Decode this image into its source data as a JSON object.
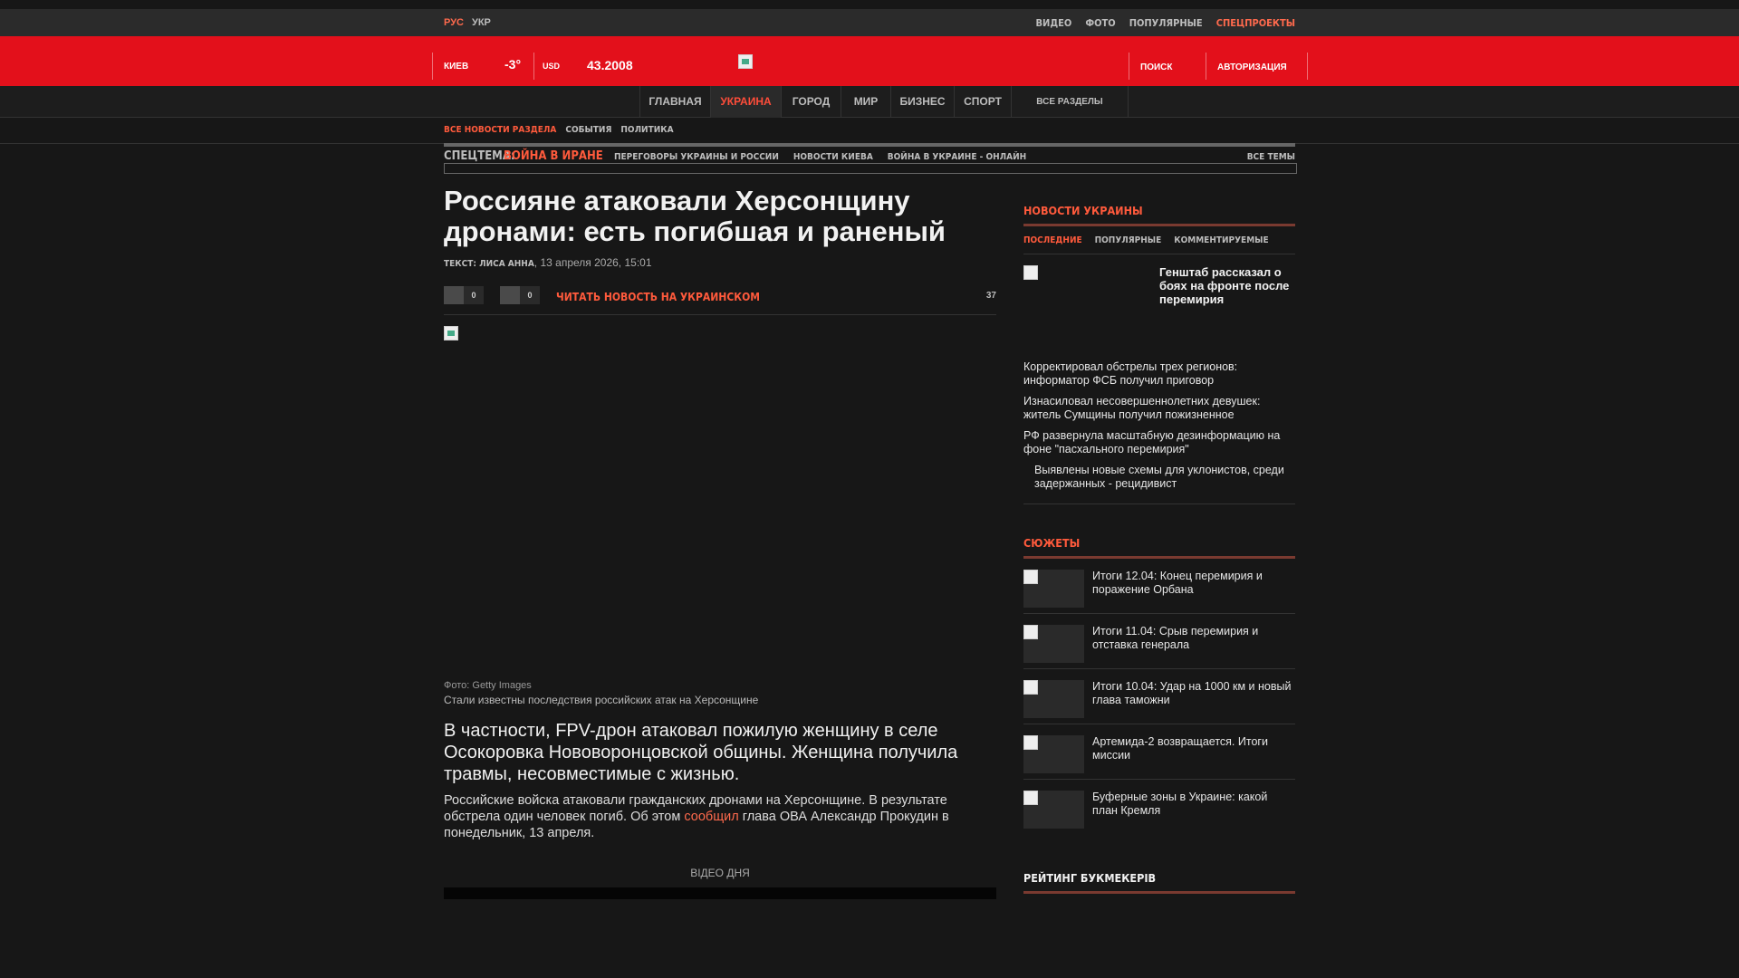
{
  "topbar": {
    "lang_ru": "РУС",
    "lang_ua": "УКР",
    "links": [
      {
        "label": "ВИДЕО",
        "active": false
      },
      {
        "label": "ФОТО",
        "active": false
      },
      {
        "label": "ПОПУЛЯРНЫЕ",
        "active": false
      },
      {
        "label": "СПЕЦПРОЕКТЫ",
        "active": true
      }
    ]
  },
  "header": {
    "city": "КИЕВ",
    "temperature": "-3°",
    "currency": "USD",
    "rate": "43.2008",
    "search": "ПОИСК",
    "auth": "АВТОРИЗАЦИЯ"
  },
  "nav": {
    "items": [
      {
        "label": "ГЛАВНАЯ"
      },
      {
        "label": "УКРАИНА"
      },
      {
        "label": "ГОРОД"
      },
      {
        "label": "МИР"
      },
      {
        "label": "БИЗНЕС"
      },
      {
        "label": "СПОРТ"
      },
      {
        "label": "ВСЕ РАЗДЕЛЫ"
      }
    ]
  },
  "subnav": {
    "items": [
      "ВСЕ НОВОСТИ РАЗДЕЛА",
      "СОБЫТИЯ",
      "ПОЛИТИКА"
    ]
  },
  "spec": {
    "label": "СПЕЦТЕМА:",
    "topic": "ВОЙНА В ИРАНЕ",
    "links": [
      "ПЕРЕГОВОРЫ УКРАИНЫ И РОССИИ",
      "НОВОСТИ КИЕВА",
      "ВОЙНА В УКРАИНЕ - ОНЛАЙН"
    ],
    "all": "ВСЕ ТЕМЫ"
  },
  "article": {
    "title": "Россияне атаковали Херсонщину дронами: есть погибшая и раненый",
    "author": "ТЕКСТ: ЛИСА АННА",
    "date": "13 апреля 2026, 15:01",
    "share_count_1": "0",
    "share_count_2": "0",
    "read_ua": "ЧИТАТЬ НОВОСТЬ НА УКРАИНСКОМ",
    "views": "37",
    "photo_credit": "Фото: Getty Images",
    "caption": "Стали известны последствия российских атак на Херсонщине",
    "lead": "В частности, FPV-дрон атаковал пожилую женщину в селе Осокоровка Нововоронцовской общины. Женщина получила травмы, несовместимые с жизнью.",
    "body_part1": "Российские войска атаковали гражданских дронами на Херсонщине. В результате обстрела один человек погиб. Об этом",
    "body_link": "сообщил",
    "body_part2": "глава ОВА Александр Прокудин в понедельник, 13 апреля.",
    "video_day": "ВІДЕО ДНЯ"
  },
  "sidebar": {
    "news_title": "НОВОСТИ УКРАИНЫ",
    "tabs": [
      "ПОСЛЕДНИЕ",
      "ПОПУЛЯРНЫЕ",
      "КОММЕНТИРУЕМЫЕ"
    ],
    "featured": "Генштаб рассказал о боях на фронте после перемирия",
    "news": [
      "Корректировал обстрелы трех регионов: информатор ФСБ получил приговор",
      "Изнасиловал несовершеннолетних девушек: житель Сумщины получил пожизненное",
      "РФ развернула масштабную дезинформацию на фоне \"пасхального перемирия\"",
      "Выявлены новые схемы для уклонистов, среди задержанных - рецидивист"
    ],
    "stories_title": "СЮЖЕТЫ",
    "stories": [
      "Итоги 12.04: Конец перемирия и поражение Орбана",
      "Итоги 11.04: Срыв перемирия и отставка генерала",
      "Итоги 10.04: Удар на 1000 км и новый глава таможни",
      "Артемида-2 возвращается. Итоги миссии",
      "Буферные зоны в Украине: какой план Кремля"
    ],
    "rating_title": "РЕЙТИНГ БУКМЕКЕРІВ"
  },
  "colors": {
    "accent": "#e3101b",
    "link": "#ff5a3c"
  }
}
